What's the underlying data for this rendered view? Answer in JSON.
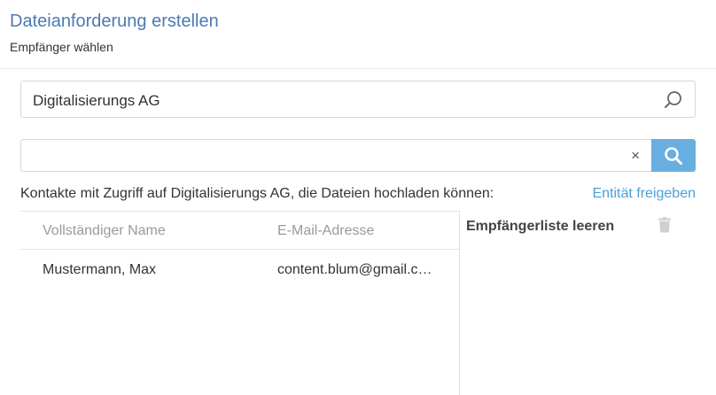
{
  "header": {
    "title": "Dateianforderung erstellen",
    "subtitle": "Empfänger wählen"
  },
  "entity_select": {
    "value": "Digitalisierungs AG",
    "icon": "search-icon"
  },
  "contact_search": {
    "value": "",
    "clear_glyph": "×",
    "button_icon": "search-icon"
  },
  "info": {
    "text": "Kontakte mit Zugriff auf Digitalisierungs AG, die Dateien hochladen können:",
    "share_link": "Entität freigeben"
  },
  "table": {
    "columns": [
      "Vollständiger Name",
      "E-Mail-Adresse"
    ],
    "rows": [
      {
        "name": "Mustermann, Max",
        "email": "content.blum@gmail.com"
      }
    ]
  },
  "recipients": {
    "title": "Empfängerliste leeren",
    "clear_icon": "trash-icon"
  },
  "colors": {
    "title": "#4a7bb5",
    "link": "#4a9fd8",
    "search_button": "#68aee0"
  }
}
